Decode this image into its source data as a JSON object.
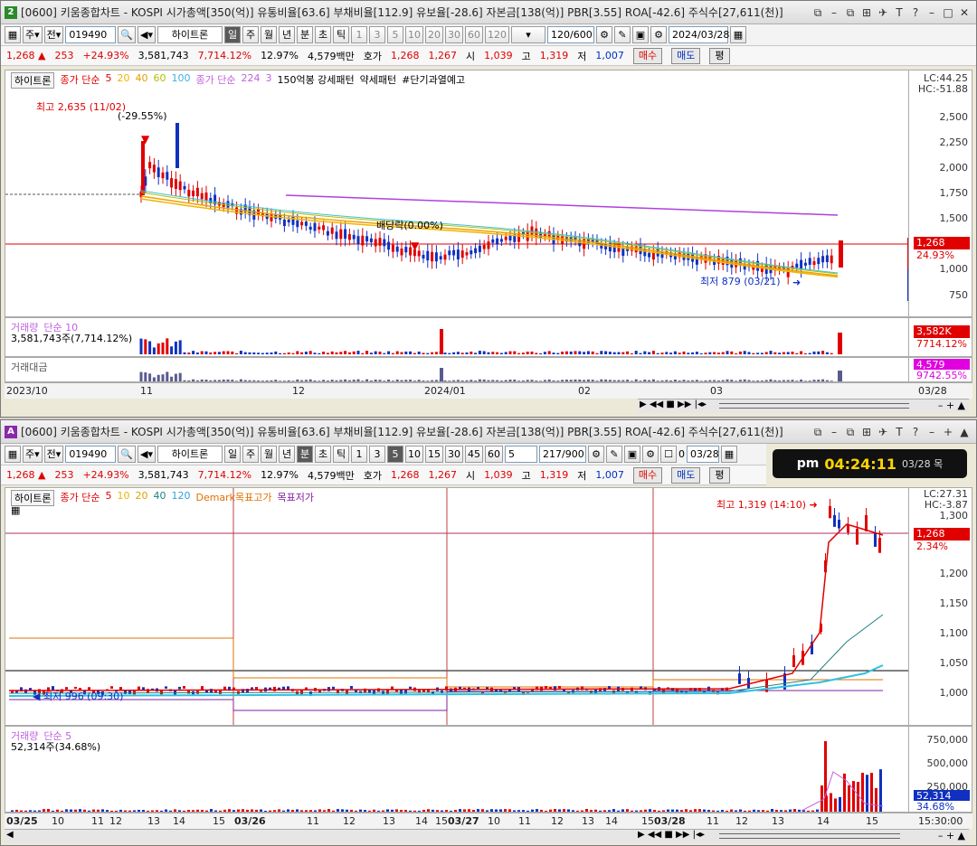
{
  "top": {
    "badge": "2",
    "badge_color": "#2a8a2a",
    "title": "[0600] 키움종합차트 - KOSPI 시가총액[350(억)] 유통비율[63.6] 부채비율[112.9] 유보율[-28.6] 자본금[138(억)] PBR[3.55] ROA[-42.6] 주식수[27,611(천)]",
    "code": "019490",
    "name": "하이트론",
    "periods": [
      "일",
      "주",
      "월",
      "년",
      "분",
      "초",
      "틱"
    ],
    "selected_period": "일",
    "intervals": [
      "1",
      "3",
      "5",
      "10",
      "20",
      "30",
      "60",
      "120"
    ],
    "count": "120/600",
    "date": "2024/03/28",
    "quote": {
      "price": "1,268",
      "arrow": "▲",
      "change": "253",
      "rate": "+24.93%",
      "volume": "3,581,743",
      "vol_rate": "7,714.12%",
      "turnover": "12.97%",
      "amount": "4,579백만",
      "ask_label": "호가",
      "ask": "1,268",
      "bid": "1,267",
      "open_label": "시",
      "open": "1,039",
      "high_label": "고",
      "high": "1,319",
      "low_label": "저",
      "low": "1,007",
      "buy": "매수",
      "sell": "매도",
      "avg": "평"
    },
    "legend": {
      "name": "하이트론",
      "ma_label": "종가 단순",
      "ma": [
        "5",
        "20",
        "40",
        "60",
        "100"
      ],
      "ma2_label": "종가 단순",
      "ma2": [
        "224",
        "3"
      ],
      "extra": [
        "150억봉 강세패턴",
        "약세패턴",
        "#단기과열예고"
      ]
    },
    "annotations": {
      "high": "최고 2,635 (11/02)",
      "high_pct": "(-29.55%)",
      "div": "배당락(0.00%)",
      "low": "최저 879 (03/21)"
    },
    "lc": "LC:44.25",
    "hc": "HC:-51.88",
    "yticks": [
      "2,500",
      "2,250",
      "2,000",
      "1,750",
      "1,500",
      "1,000",
      "750"
    ],
    "price_tag": "1,268",
    "pct_tag": "24.93%",
    "vol": {
      "label": "거래량",
      "ma": "단순 10",
      "value": "3,581,743주(7,714.12%)",
      "tag": "3,582K",
      "tag2": "7714.12%"
    },
    "amt": {
      "label": "거래대금",
      "tag": "4,579",
      "tag2": "9742.55%"
    },
    "xlabels": [
      "2023/10",
      "11",
      "12",
      "2024/01",
      "02",
      "03"
    ],
    "xend": "03/28"
  },
  "bottom": {
    "badge": "A",
    "badge_color": "#8a2aa8",
    "title": "[0600] 키움종합차트 - KOSPI 시가총액[350(억)] 유통비율[63.6] 부채비율[112.9] 유보율[-28.6] 자본금[138(억)] PBR[3.55] ROA[-42.6] 주식수[27,611(천)]",
    "code": "019490",
    "name": "하이트론",
    "periods": [
      "일",
      "주",
      "월",
      "년",
      "분",
      "초",
      "틱"
    ],
    "selected_period": "분",
    "intervals": [
      "1",
      "3",
      "5",
      "10",
      "15",
      "30",
      "45",
      "60"
    ],
    "interval_select": "5",
    "count": "217/900",
    "date": "03/28",
    "chk": "0",
    "quote": {
      "price": "1,268",
      "arrow": "▲",
      "change": "253",
      "rate": "+24.93%",
      "volume": "3,581,743",
      "vol_rate": "7,714.12%",
      "turnover": "12.97%",
      "amount": "4,579백만",
      "ask_label": "호가",
      "ask": "1,268",
      "bid": "1,267",
      "open_label": "시",
      "open": "1,039",
      "high_label": "고",
      "high": "1,319",
      "low_label": "저",
      "low": "1,007",
      "buy": "매수",
      "sell": "매도",
      "avg": "평"
    },
    "legend": {
      "name": "하이트론",
      "ma_label": "종가 단순",
      "ma": [
        "5",
        "10",
        "20",
        "40",
        "120"
      ],
      "demark": "Demark목표고가",
      "demark2": "목표저가"
    },
    "annotations": {
      "high": "최고 1,319 (14:10)",
      "low": "최저 996 (09:30)"
    },
    "lc": "LC:27.31",
    "hc": "HC:-3.87",
    "yticks": [
      "1,300",
      "1,250",
      "1,200",
      "1,150",
      "1,100",
      "1,050",
      "1,000"
    ],
    "price_tag": "1,268",
    "pct_tag": "2.34%",
    "vol": {
      "label": "거래량",
      "ma": "단순 5",
      "value": "52,314주(34.68%)",
      "tag": "52,314",
      "tag2": "34.68%",
      "yticks": [
        "750,000",
        "500,000",
        "250,000"
      ]
    },
    "xlabels": [
      "03/25",
      "10",
      "11",
      "12",
      "13",
      "14",
      "15",
      "03/26",
      "11",
      "12",
      "13",
      "14",
      "15",
      "03/27",
      "10",
      "11",
      "12",
      "13",
      "14",
      "15",
      "03/28",
      "11",
      "12",
      "13",
      "14",
      "15"
    ],
    "xend": "15:30:00"
  },
  "clock": {
    "ampm": "pm",
    "time": "04:24:11",
    "date": "03/28 목"
  },
  "colors": {
    "up": "#e00000",
    "down": "#1030c0",
    "ma5": "#e00000",
    "ma20": "#f2b400",
    "ma40": "#f0a000",
    "ma60": "#b0c000",
    "ma100": "#40c0e0",
    "ma224": "#b040e0"
  }
}
